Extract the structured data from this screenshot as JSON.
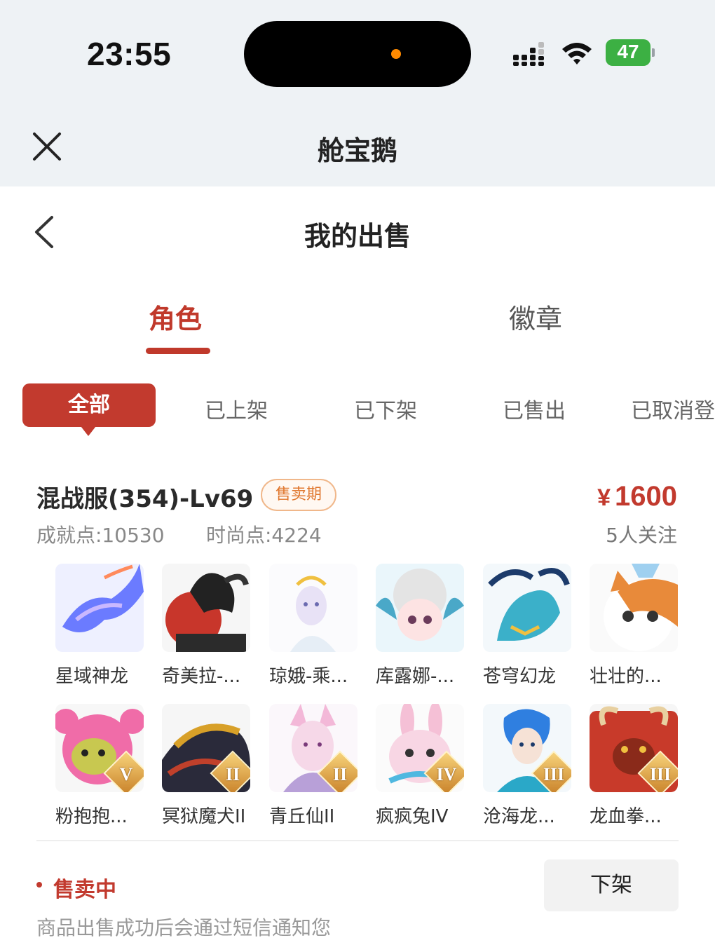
{
  "status_bar": {
    "time": "23:55",
    "battery": "47"
  },
  "app_header": {
    "title": "舱宝鹅"
  },
  "page_header": {
    "title": "我的出售"
  },
  "tabs": [
    {
      "label": "角色",
      "active": true
    },
    {
      "label": "徽章",
      "active": false
    }
  ],
  "filters": {
    "active": "全部",
    "items": [
      "已上架",
      "已下架",
      "已售出",
      "已取消登"
    ]
  },
  "listing": {
    "server": "混战服(354)-Lv69",
    "status_tag": "售卖期",
    "price_symbol": "¥",
    "price": "1600",
    "achievement": "成就点:10530",
    "fashion": "时尚点:4224",
    "followers": "5人关注",
    "pets": [
      {
        "name": "星域神龙",
        "icon": "star-dragon-icon"
      },
      {
        "name": "奇美拉-...",
        "icon": "chimera-icon"
      },
      {
        "name": "琼娥-乘...",
        "icon": "fairy-icon"
      },
      {
        "name": "库露娜-...",
        "icon": "kuluna-icon"
      },
      {
        "name": "苍穹幻龙",
        "icon": "sky-dragon-icon"
      },
      {
        "name": "壮壮的...",
        "icon": "cat-icon"
      },
      {
        "name": "粉抱抱...",
        "icon": "pink-bear-icon",
        "rank": "V"
      },
      {
        "name": "冥狱魔犬II",
        "icon": "hell-hound-icon",
        "rank": "II"
      },
      {
        "name": "青丘仙II",
        "icon": "fox-fairy-icon",
        "rank": "II"
      },
      {
        "name": "疯疯兔IV",
        "icon": "rabbit-icon",
        "rank": "IV"
      },
      {
        "name": "沧海龙...",
        "icon": "sea-dragon-icon",
        "rank": "III"
      },
      {
        "name": "龙血拳...",
        "icon": "dragon-fist-icon",
        "rank": "III"
      }
    ],
    "selling_label": "售卖中",
    "delist_button": "下架",
    "notice": "商品出售成功后会通过短信通知您"
  },
  "colors": {
    "accent": "#c23a2e",
    "tag": "#e0772e",
    "header_bg": "#eef2f5"
  }
}
